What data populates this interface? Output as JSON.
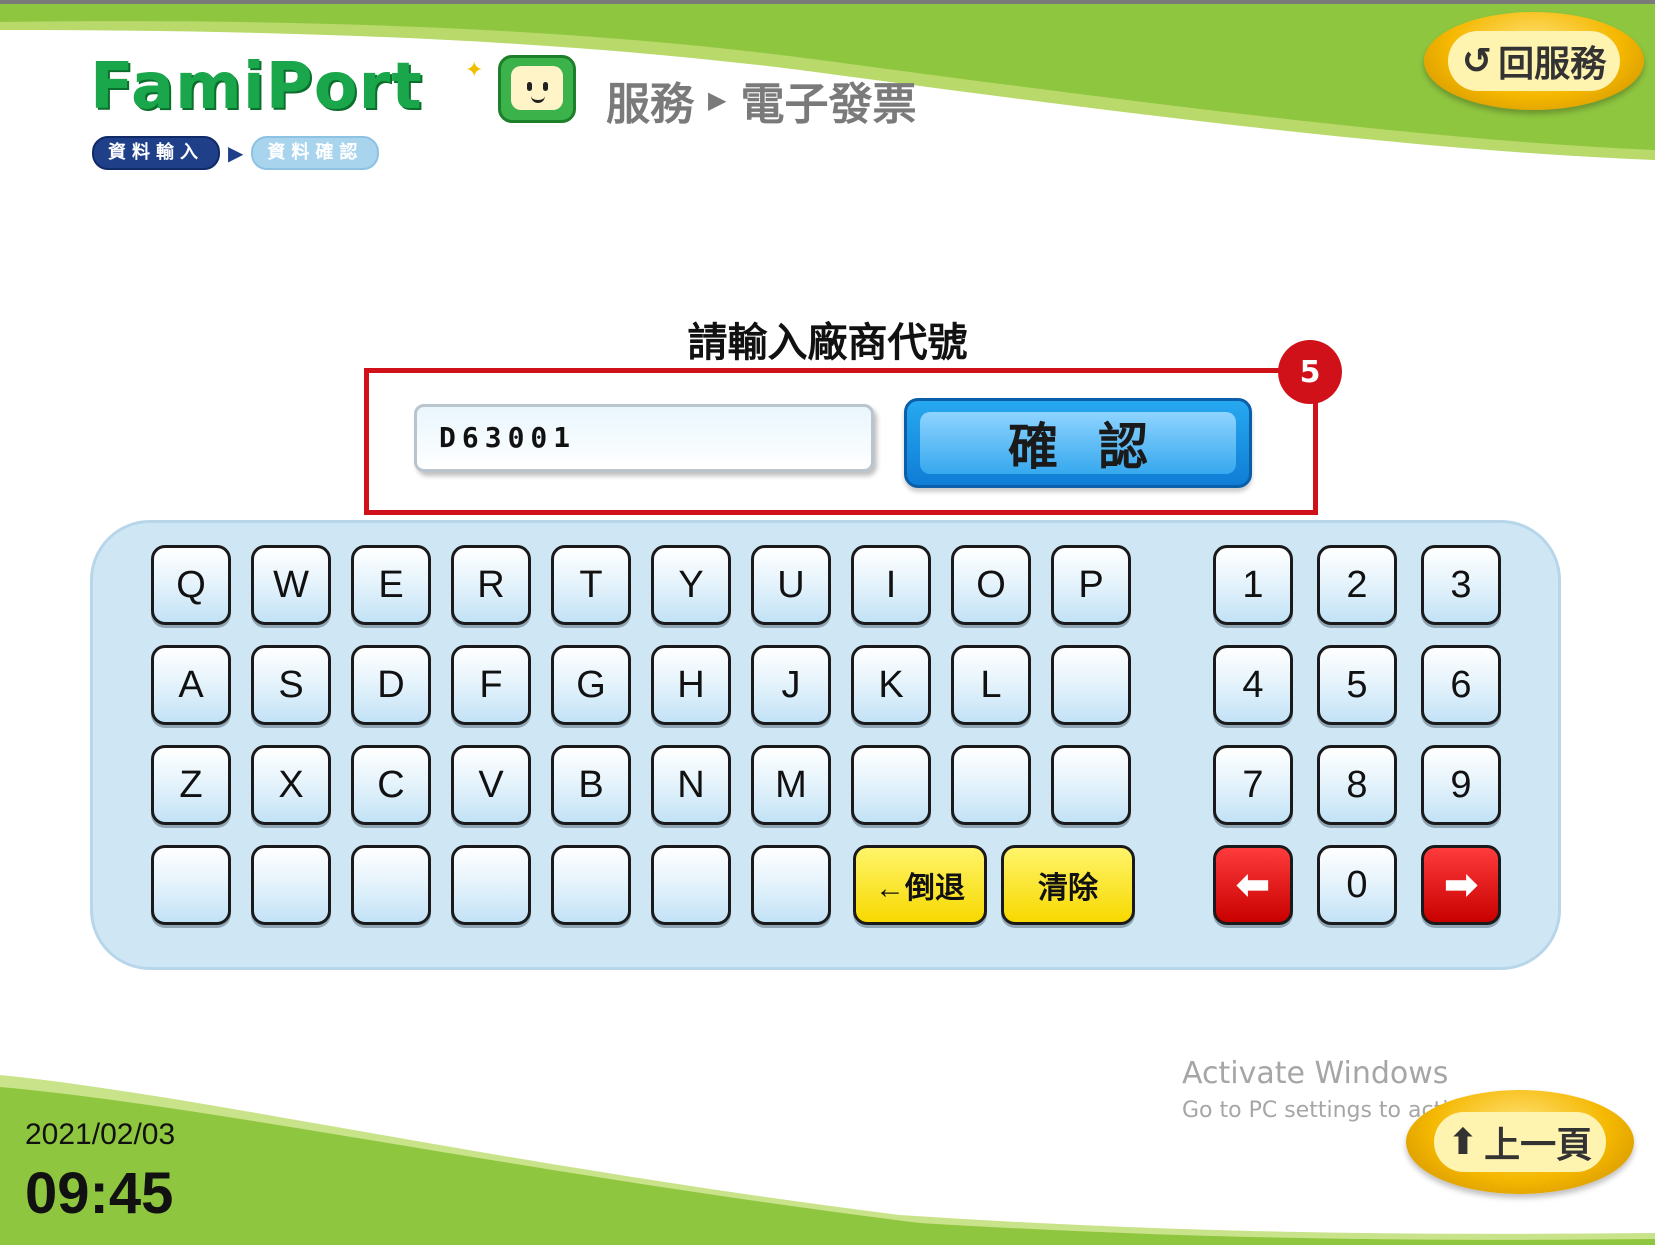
{
  "header": {
    "logo": "FamiPort",
    "breadcrumb": [
      "服務",
      "電子發票"
    ],
    "return_button": "回服務"
  },
  "steps": [
    "資料輸入",
    "資料確認"
  ],
  "prompt": "請輸入廠商代號",
  "vendor_input": {
    "value": "D63001"
  },
  "confirm_button": "確認",
  "step_badge": "5",
  "keyboard": {
    "rows": [
      [
        "Q",
        "W",
        "E",
        "R",
        "T",
        "Y",
        "U",
        "I",
        "O",
        "P"
      ],
      [
        "A",
        "S",
        "D",
        "F",
        "G",
        "H",
        "J",
        "K",
        "L",
        ""
      ],
      [
        "Z",
        "X",
        "C",
        "V",
        "B",
        "N",
        "M",
        "",
        "",
        ""
      ],
      [
        "",
        "",
        "",
        "",
        "",
        "",
        ""
      ]
    ],
    "numpad": [
      [
        "1",
        "2",
        "3"
      ],
      [
        "4",
        "5",
        "6"
      ],
      [
        "7",
        "8",
        "9"
      ]
    ],
    "backspace": "←倒退",
    "clear": "清除",
    "zero": "0",
    "left_arrow": "⬅",
    "right_arrow": "➡"
  },
  "footer": {
    "date": "2021/02/03",
    "time": "09:45",
    "prev_button": "上一頁"
  },
  "watermark": {
    "title": "Activate Windows",
    "subtitle": "Go to PC settings to activate Windows."
  },
  "colors": {
    "brand_green": "#8fc63f",
    "highlight_red": "#d0111a",
    "confirm_blue": "#1b8fe0",
    "key_yellow": "#f7d900",
    "key_red": "#c80000"
  }
}
